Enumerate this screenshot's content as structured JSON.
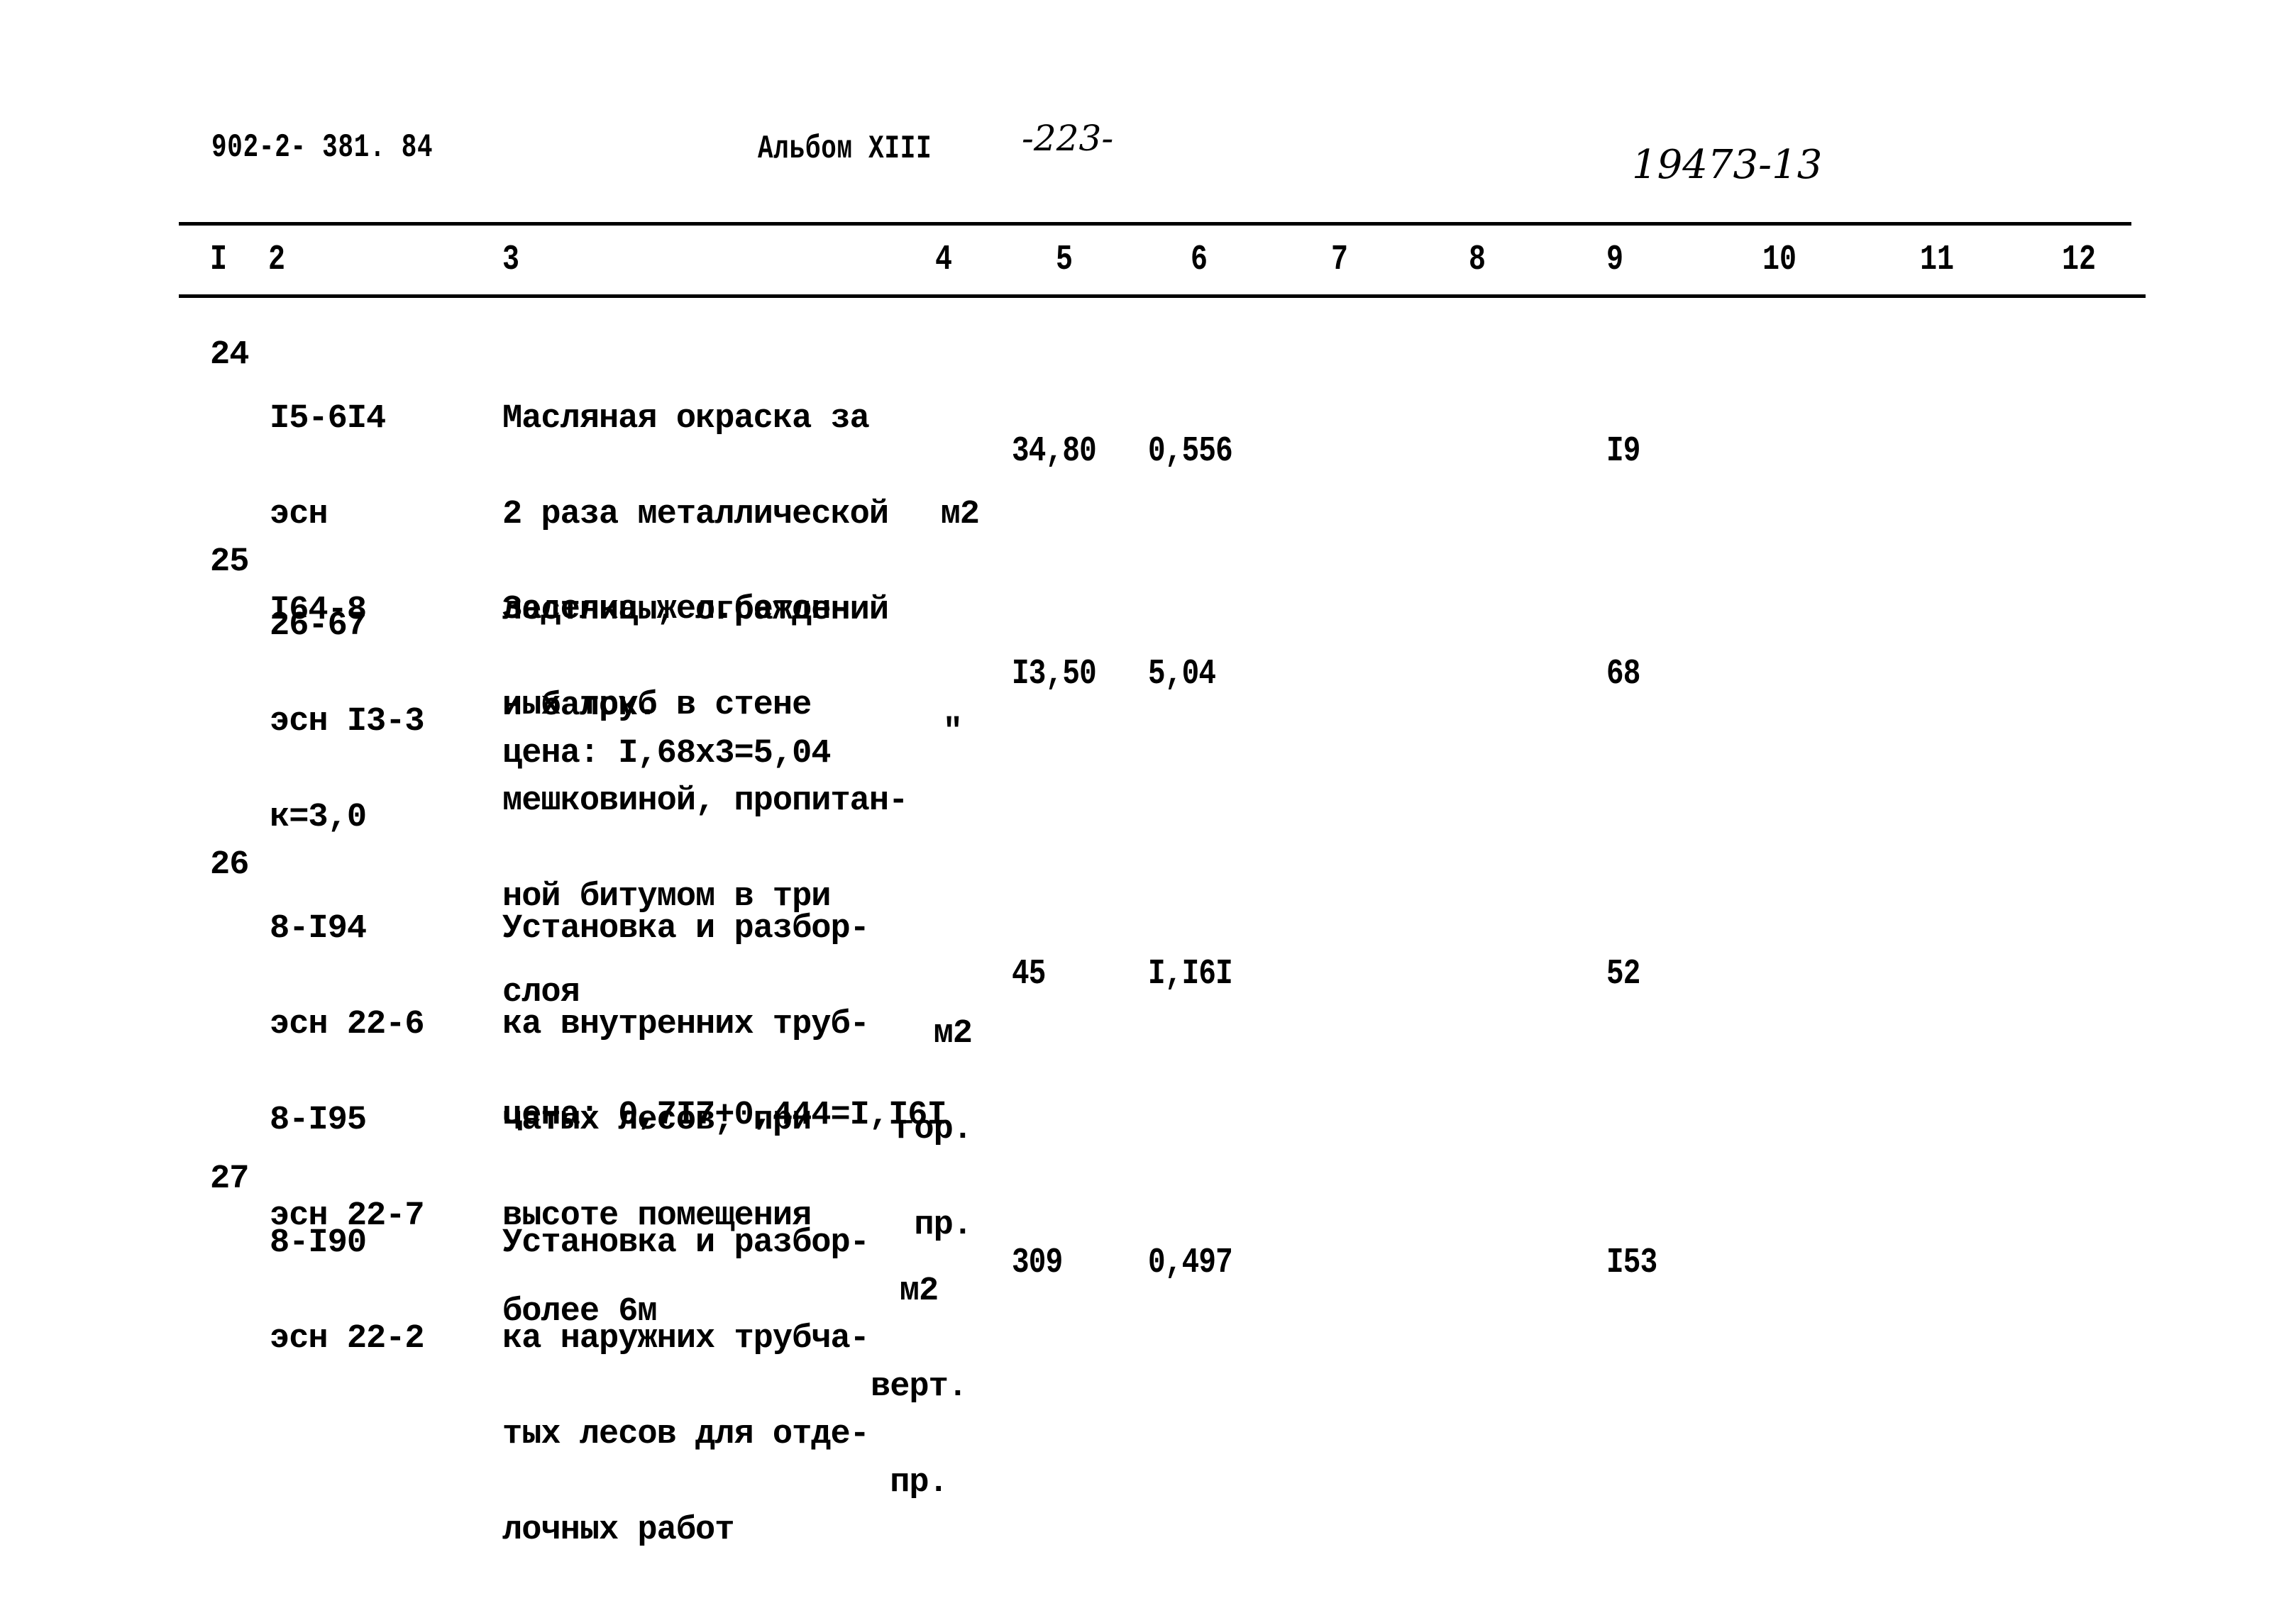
{
  "header": {
    "doc_code": "902-2- 381. 84",
    "album": "Альбом XIII",
    "page": "-223-",
    "handwritten_number": "19473-13"
  },
  "columns": [
    "I",
    "2",
    "3",
    "4",
    "5",
    "6",
    "7",
    "8",
    "9",
    "10",
    "11",
    "12"
  ],
  "rows": [
    {
      "no": "24",
      "code_lines": [
        "I5-6I4",
        "эсн",
        "I64-8"
      ],
      "description_lines": [
        "Масляная окраска за",
        "2 раза металлической",
        "лестницы, ограждений",
        "и балок."
      ],
      "unit_lines": [
        "м2"
      ],
      "quantity": "34,80",
      "price": "0,556",
      "total": "I9",
      "price_note": ""
    },
    {
      "no": "25",
      "code_lines": [
        "26-67",
        "эсн I3-3",
        "к=3,0"
      ],
      "description_lines": [
        "Заделка жел.бетон-",
        "ных труб в стене",
        "мешковиной, пропитан-",
        "ной битумом в три",
        "слоя"
      ],
      "unit_lines": [
        "\""
      ],
      "quantity": "I3,50",
      "price": "5,04",
      "total": "68",
      "price_note": "цена: I,68x3=5,04"
    },
    {
      "no": "26",
      "code_lines": [
        "8-I94",
        "эсн 22-6",
        "8-I95",
        "эсн 22-7"
      ],
      "description_lines": [
        "Установка и разбор-",
        "ка внутренних труб-",
        "чатых лесов, при",
        "высоте помещения",
        "более 6м"
      ],
      "unit_lines": [
        "м2",
        "гор.",
        "пр."
      ],
      "quantity": "45",
      "price": "I,I6I",
      "total": "52",
      "price_note": "цена: 0,7I7+0,444=I,I6I"
    },
    {
      "no": "27",
      "code_lines": [
        "8-I90",
        "эсн 22-2"
      ],
      "description_lines": [
        "Установка и разбор-",
        "ка наружних трубча-",
        "тых лесов для отде-",
        "лочных работ"
      ],
      "unit_lines": [
        "м2",
        "верт.",
        "пр."
      ],
      "quantity": "309",
      "price": "0,497",
      "total": "I53",
      "price_note": ""
    }
  ]
}
